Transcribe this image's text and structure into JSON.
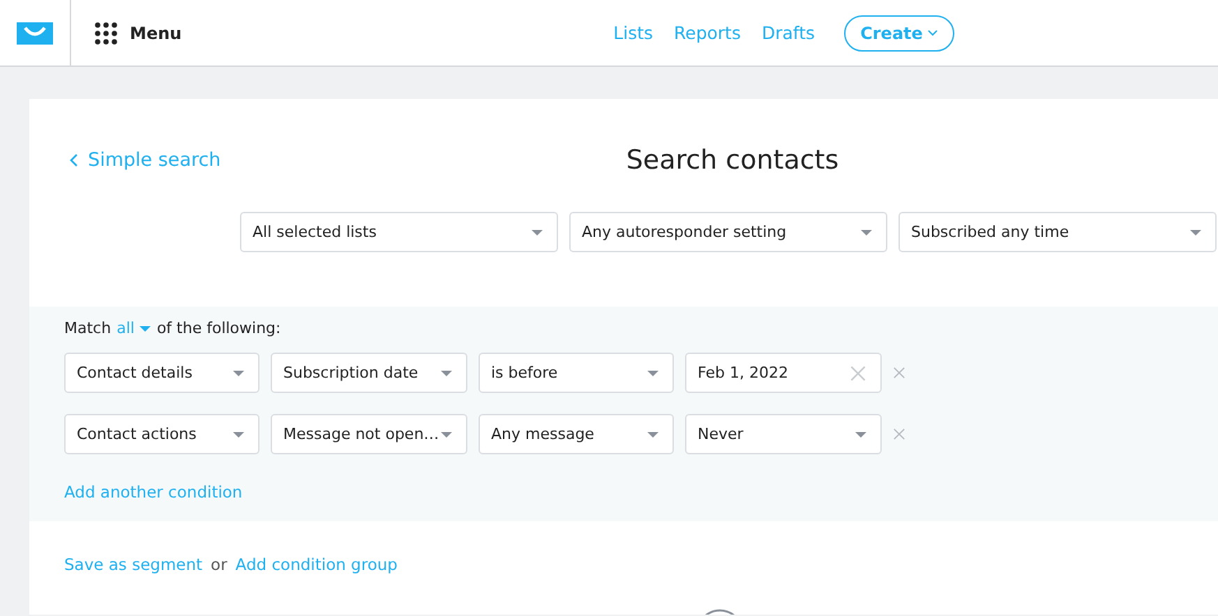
{
  "header": {
    "menu_label": "Menu",
    "nav_links": [
      "Lists",
      "Reports",
      "Drafts"
    ],
    "create_button": "Create"
  },
  "back_link": "Simple search",
  "title": "Search contacts",
  "filters": [
    "All selected lists",
    "Any autoresponder setting",
    "Subscribed any time"
  ],
  "match": {
    "prefix": "Match",
    "mode": "all",
    "suffix": "of the following:"
  },
  "conditions": [
    {
      "fields": [
        {
          "kind": "select",
          "value": "Contact details"
        },
        {
          "kind": "select",
          "value": "Subscription date"
        },
        {
          "kind": "select",
          "value": "is before"
        },
        {
          "kind": "date",
          "value": "Feb 1, 2022"
        }
      ]
    },
    {
      "fields": [
        {
          "kind": "select",
          "value": "Contact actions"
        },
        {
          "kind": "select",
          "value": "Message not open…"
        },
        {
          "kind": "select",
          "value": "Any message"
        },
        {
          "kind": "select",
          "value": "Never"
        }
      ]
    }
  ],
  "add_condition": "Add another condition",
  "footer": {
    "save_link": "Save as segment",
    "or": "or",
    "group_link": "Add condition group"
  }
}
